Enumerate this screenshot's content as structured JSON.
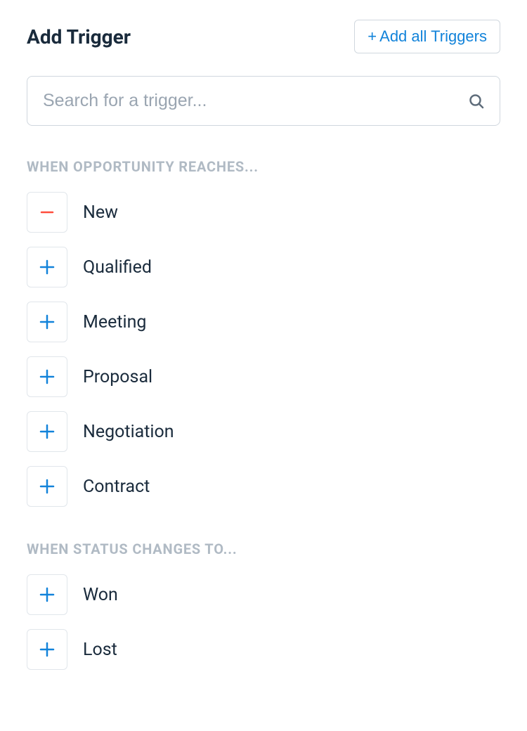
{
  "header": {
    "title": "Add Trigger",
    "add_all_label": "Add all Triggers"
  },
  "search": {
    "placeholder": "Search for a trigger...",
    "value": ""
  },
  "sections": {
    "opportunity": {
      "heading": "WHEN OPPORTUNITY REACHES...",
      "items": [
        {
          "label": "New",
          "state": "added"
        },
        {
          "label": "Qualified",
          "state": "add"
        },
        {
          "label": "Meeting",
          "state": "add"
        },
        {
          "label": "Proposal",
          "state": "add"
        },
        {
          "label": "Negotiation",
          "state": "add"
        },
        {
          "label": "Contract",
          "state": "add"
        }
      ]
    },
    "status": {
      "heading": "WHEN STATUS CHANGES TO...",
      "items": [
        {
          "label": "Won",
          "state": "add"
        },
        {
          "label": "Lost",
          "state": "add"
        }
      ]
    }
  }
}
